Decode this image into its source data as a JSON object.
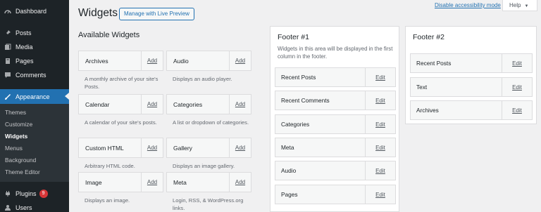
{
  "sidebar": {
    "items": [
      {
        "label": "Dashboard",
        "icon": "dashboard-icon"
      },
      {
        "label": "Posts",
        "icon": "pin-icon"
      },
      {
        "label": "Media",
        "icon": "media-icon"
      },
      {
        "label": "Pages",
        "icon": "pages-icon"
      },
      {
        "label": "Comments",
        "icon": "comments-icon"
      },
      {
        "label": "Appearance",
        "icon": "brush-icon"
      }
    ],
    "submenu": [
      "Themes",
      "Customize",
      "Widgets",
      "Menus",
      "Background",
      "Theme Editor"
    ],
    "plugins": {
      "label": "Plugins",
      "badge": "9",
      "icon": "plugin-icon"
    },
    "users": {
      "label": "Users",
      "icon": "users-icon"
    }
  },
  "header": {
    "title": "Widgets",
    "live_preview": "Manage with Live Preview",
    "a11y": "Disable accessibility mode",
    "help": "Help"
  },
  "available": {
    "title": "Available Widgets",
    "add_label": "Add",
    "widgets": [
      {
        "name": "Archives",
        "desc": "A monthly archive of your site's Posts."
      },
      {
        "name": "Audio",
        "desc": "Displays an audio player."
      },
      {
        "name": "Calendar",
        "desc": "A calendar of your site's posts."
      },
      {
        "name": "Categories",
        "desc": "A list or dropdown of categories."
      },
      {
        "name": "Custom HTML",
        "desc": "Arbitrary HTML code."
      },
      {
        "name": "Gallery",
        "desc": "Displays an image gallery."
      },
      {
        "name": "Image",
        "desc": "Displays an image."
      },
      {
        "name": "Meta",
        "desc": "Login, RSS, & WordPress.org links."
      }
    ]
  },
  "footer1": {
    "title": "Footer #1",
    "desc": "Widgets in this area will be displayed in the first column in the footer.",
    "edit_label": "Edit",
    "widgets": [
      "Recent Posts",
      "Recent Comments",
      "Categories",
      "Meta",
      "Audio",
      "Pages"
    ]
  },
  "footer2": {
    "title": "Footer #2",
    "edit_label": "Edit",
    "widgets": [
      "Recent Posts",
      "Text",
      "Archives"
    ]
  },
  "colors": {
    "sidebar_bg": "#1d2327",
    "accent": "#2271b1",
    "badge": "#d63638"
  }
}
